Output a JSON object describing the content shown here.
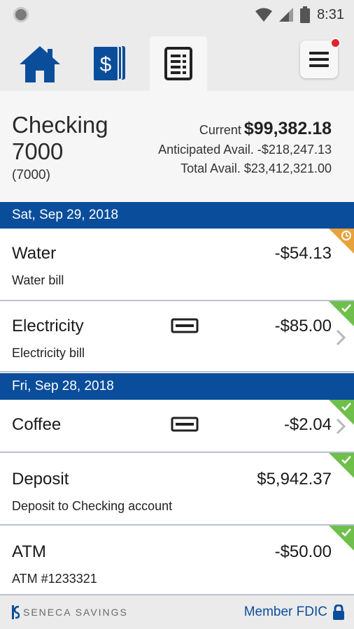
{
  "status_bar": {
    "time": "8:31"
  },
  "tabs": [
    {
      "name": "home",
      "icon": "home-icon"
    },
    {
      "name": "accounts",
      "icon": "dollar-cards-icon"
    },
    {
      "name": "statements",
      "icon": "statement-icon",
      "selected": true
    }
  ],
  "colors": {
    "brand": "#0a4e9b",
    "pending": "#e9a23b",
    "cleared": "#6fbf4b",
    "notification": "#e0242f"
  },
  "account": {
    "name": "Checking 7000",
    "number": "(7000)",
    "current_label": "Current",
    "current_value": "$99,382.18",
    "anticipated": "Anticipated Avail. -$218,247.13",
    "total": "Total Avail. $23,412,321.00"
  },
  "groups": [
    {
      "date": "Sat, Sep 29, 2018",
      "transactions": [
        {
          "name": "Water",
          "amount": "-$54.13",
          "description": "Water bill",
          "status": "pending"
        },
        {
          "name": "Electricity",
          "amount": "-$85.00",
          "description": "Electricity bill",
          "status": "cleared",
          "card": true
        }
      ]
    },
    {
      "date": "Fri, Sep 28, 2018",
      "transactions": [
        {
          "name": "Coffee",
          "amount": "-$2.04",
          "description": "",
          "status": "cleared",
          "card": true
        },
        {
          "name": "Deposit",
          "amount": "$5,942.37",
          "description": "Deposit to Checking account",
          "status": "cleared"
        },
        {
          "name": "ATM",
          "amount": "-$50.00",
          "description": "ATM #1233321",
          "status": "cleared"
        }
      ]
    }
  ],
  "footer": {
    "bank_name": "SENECA SAVINGS",
    "fdic": "Member FDIC"
  }
}
